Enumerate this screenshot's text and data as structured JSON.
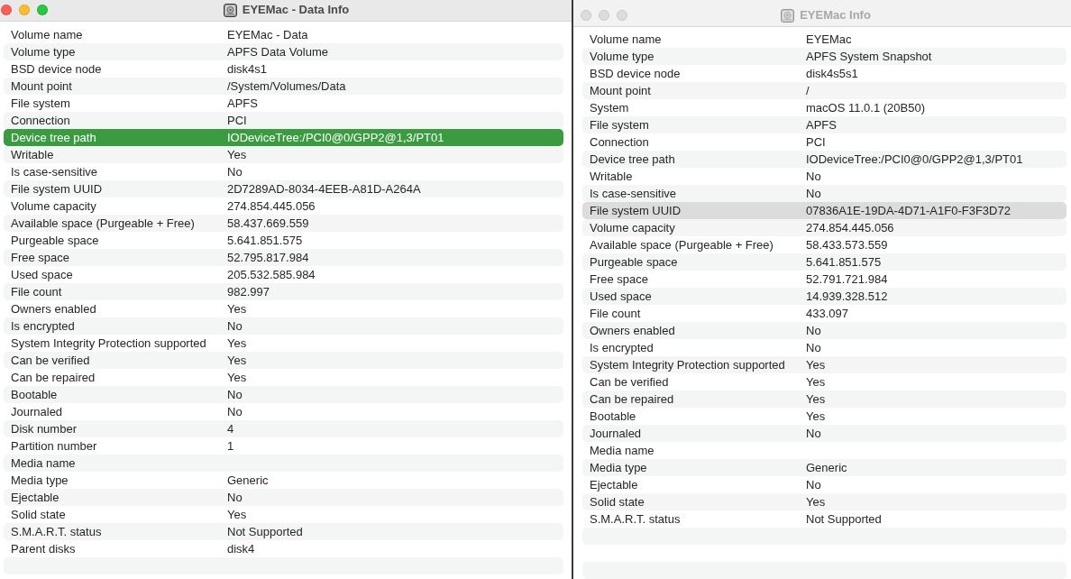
{
  "windows": [
    {
      "title": "EYEMac - Data Info",
      "active": true,
      "rows": [
        {
          "label": "Volume name",
          "value": "EYEMac - Data",
          "selected": false
        },
        {
          "label": "Volume type",
          "value": "APFS Data Volume",
          "selected": false
        },
        {
          "label": "BSD device node",
          "value": "disk4s1",
          "selected": false
        },
        {
          "label": "Mount point",
          "value": "/System/Volumes/Data",
          "selected": false
        },
        {
          "label": "File system",
          "value": "APFS",
          "selected": false
        },
        {
          "label": "Connection",
          "value": "PCI",
          "selected": false
        },
        {
          "label": "Device tree path",
          "value": "IODeviceTree:/PCI0@0/GPP2@1,3/PT01",
          "selected": true
        },
        {
          "label": "Writable",
          "value": "Yes",
          "selected": false
        },
        {
          "label": "Is case-sensitive",
          "value": "No",
          "selected": false
        },
        {
          "label": "File system UUID",
          "value": "2D7289AD-8034-4EEB-A81D-A264A",
          "selected": false
        },
        {
          "label": "Volume capacity",
          "value": "274.854.445.056",
          "selected": false
        },
        {
          "label": "Available space (Purgeable + Free)",
          "value": "58.437.669.559",
          "selected": false
        },
        {
          "label": "Purgeable space",
          "value": "5.641.851.575",
          "selected": false
        },
        {
          "label": "Free space",
          "value": "52.795.817.984",
          "selected": false
        },
        {
          "label": "Used space",
          "value": "205.532.585.984",
          "selected": false
        },
        {
          "label": "File count",
          "value": "982.997",
          "selected": false
        },
        {
          "label": "Owners enabled",
          "value": "Yes",
          "selected": false
        },
        {
          "label": "Is encrypted",
          "value": "No",
          "selected": false
        },
        {
          "label": "System Integrity Protection supported",
          "value": "Yes",
          "selected": false
        },
        {
          "label": "Can be verified",
          "value": "Yes",
          "selected": false
        },
        {
          "label": "Can be repaired",
          "value": "Yes",
          "selected": false
        },
        {
          "label": "Bootable",
          "value": "No",
          "selected": false
        },
        {
          "label": "Journaled",
          "value": "No",
          "selected": false
        },
        {
          "label": "Disk number",
          "value": "4",
          "selected": false
        },
        {
          "label": "Partition number",
          "value": "1",
          "selected": false
        },
        {
          "label": "Media name",
          "selected": false
        },
        {
          "label": "Media type",
          "value": "Generic",
          "selected": false
        },
        {
          "label": "Ejectable",
          "value": "No",
          "selected": false
        },
        {
          "label": "Solid state",
          "value": "Yes",
          "selected": false
        },
        {
          "label": "S.M.A.R.T. status",
          "value": "Not Supported",
          "selected": false
        },
        {
          "label": "Parent disks",
          "value": "disk4",
          "selected": false
        }
      ]
    },
    {
      "title": "EYEMac Info",
      "active": false,
      "rows": [
        {
          "label": "Volume name",
          "value": "EYEMac",
          "selected": false
        },
        {
          "label": "Volume type",
          "value": "APFS System Snapshot",
          "selected": false
        },
        {
          "label": "BSD device node",
          "value": "disk4s5s1",
          "selected": false
        },
        {
          "label": "Mount point",
          "value": "/",
          "selected": false
        },
        {
          "label": "System",
          "value": "macOS 11.0.1 (20B50)",
          "selected": false
        },
        {
          "label": "File system",
          "value": "APFS",
          "selected": false
        },
        {
          "label": "Connection",
          "value": "PCI",
          "selected": false
        },
        {
          "label": "Device tree path",
          "value": "IODeviceTree:/PCI0@0/GPP2@1,3/PT01",
          "selected": false
        },
        {
          "label": "Writable",
          "value": "No",
          "selected": false
        },
        {
          "label": "Is case-sensitive",
          "value": "No",
          "selected": false
        },
        {
          "label": "File system UUID",
          "value": "07836A1E-19DA-4D71-A1F0-F3F3D72",
          "selected": true
        },
        {
          "label": "Volume capacity",
          "value": "274.854.445.056",
          "selected": false
        },
        {
          "label": "Available space (Purgeable + Free)",
          "value": "58.433.573.559",
          "selected": false
        },
        {
          "label": "Purgeable space",
          "value": "5.641.851.575",
          "selected": false
        },
        {
          "label": "Free space",
          "value": "52.791.721.984",
          "selected": false
        },
        {
          "label": "Used space",
          "value": "14.939.328.512",
          "selected": false
        },
        {
          "label": "File count",
          "value": "433.097",
          "selected": false
        },
        {
          "label": "Owners enabled",
          "value": "No",
          "selected": false
        },
        {
          "label": "Is encrypted",
          "value": "No",
          "selected": false
        },
        {
          "label": "System Integrity Protection supported",
          "value": "Yes",
          "selected": false
        },
        {
          "label": "Can be verified",
          "value": "Yes",
          "selected": false
        },
        {
          "label": "Can be repaired",
          "value": "Yes",
          "selected": false
        },
        {
          "label": "Bootable",
          "value": "Yes",
          "selected": false
        },
        {
          "label": "Journaled",
          "value": "No",
          "selected": false
        },
        {
          "label": "Media name",
          "selected": false
        },
        {
          "label": "Media type",
          "value": "Generic",
          "selected": false
        },
        {
          "label": "Ejectable",
          "value": "No",
          "selected": false
        },
        {
          "label": "Solid state",
          "value": "Yes",
          "selected": false
        },
        {
          "label": "S.M.A.R.T. status",
          "value": "Not Supported",
          "selected": false
        }
      ]
    }
  ]
}
